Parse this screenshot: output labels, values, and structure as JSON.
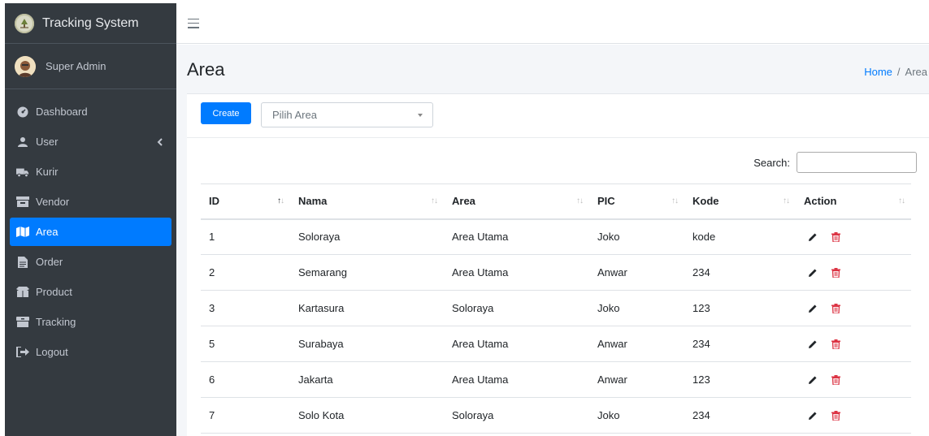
{
  "app": {
    "title": "Tracking System"
  },
  "user": {
    "name": "Super Admin"
  },
  "sidebar": {
    "items": [
      {
        "label": "Dashboard",
        "icon": "dashboard-icon"
      },
      {
        "label": "User",
        "icon": "user-icon"
      },
      {
        "label": "Kurir",
        "icon": "truck-icon"
      },
      {
        "label": "Vendor",
        "icon": "vendor-icon"
      },
      {
        "label": "Area",
        "icon": "map-icon",
        "active": true
      },
      {
        "label": "Order",
        "icon": "file-icon"
      },
      {
        "label": "Product",
        "icon": "box-icon"
      },
      {
        "label": "Tracking",
        "icon": "archive-icon"
      },
      {
        "label": "Logout",
        "icon": "logout-icon"
      }
    ]
  },
  "page": {
    "title": "Area",
    "breadcrumb": {
      "home": "Home",
      "sep": "/",
      "current": "Area"
    }
  },
  "toolbar": {
    "create_label": "Create",
    "area_select_placeholder": "Pilih Area"
  },
  "search": {
    "label": "Search:"
  },
  "table": {
    "headers": [
      "ID",
      "Nama",
      "Area",
      "PIC",
      "Kode",
      "Action"
    ],
    "rows": [
      [
        "1",
        "Soloraya",
        "Area Utama",
        "Joko",
        "kode"
      ],
      [
        "2",
        "Semarang",
        "Area Utama",
        "Anwar",
        "234"
      ],
      [
        "3",
        "Kartasura",
        "Soloraya",
        "Joko",
        "123"
      ],
      [
        "5",
        "Surabaya",
        "Area Utama",
        "Anwar",
        "234"
      ],
      [
        "6",
        "Jakarta",
        "Area Utama",
        "Anwar",
        "123"
      ],
      [
        "7",
        "Solo Kota",
        "Soloraya",
        "Joko",
        "234"
      ]
    ]
  },
  "colors": {
    "accent": "#007bff",
    "sidebar": "#343a40",
    "delete": "#dc3545"
  }
}
